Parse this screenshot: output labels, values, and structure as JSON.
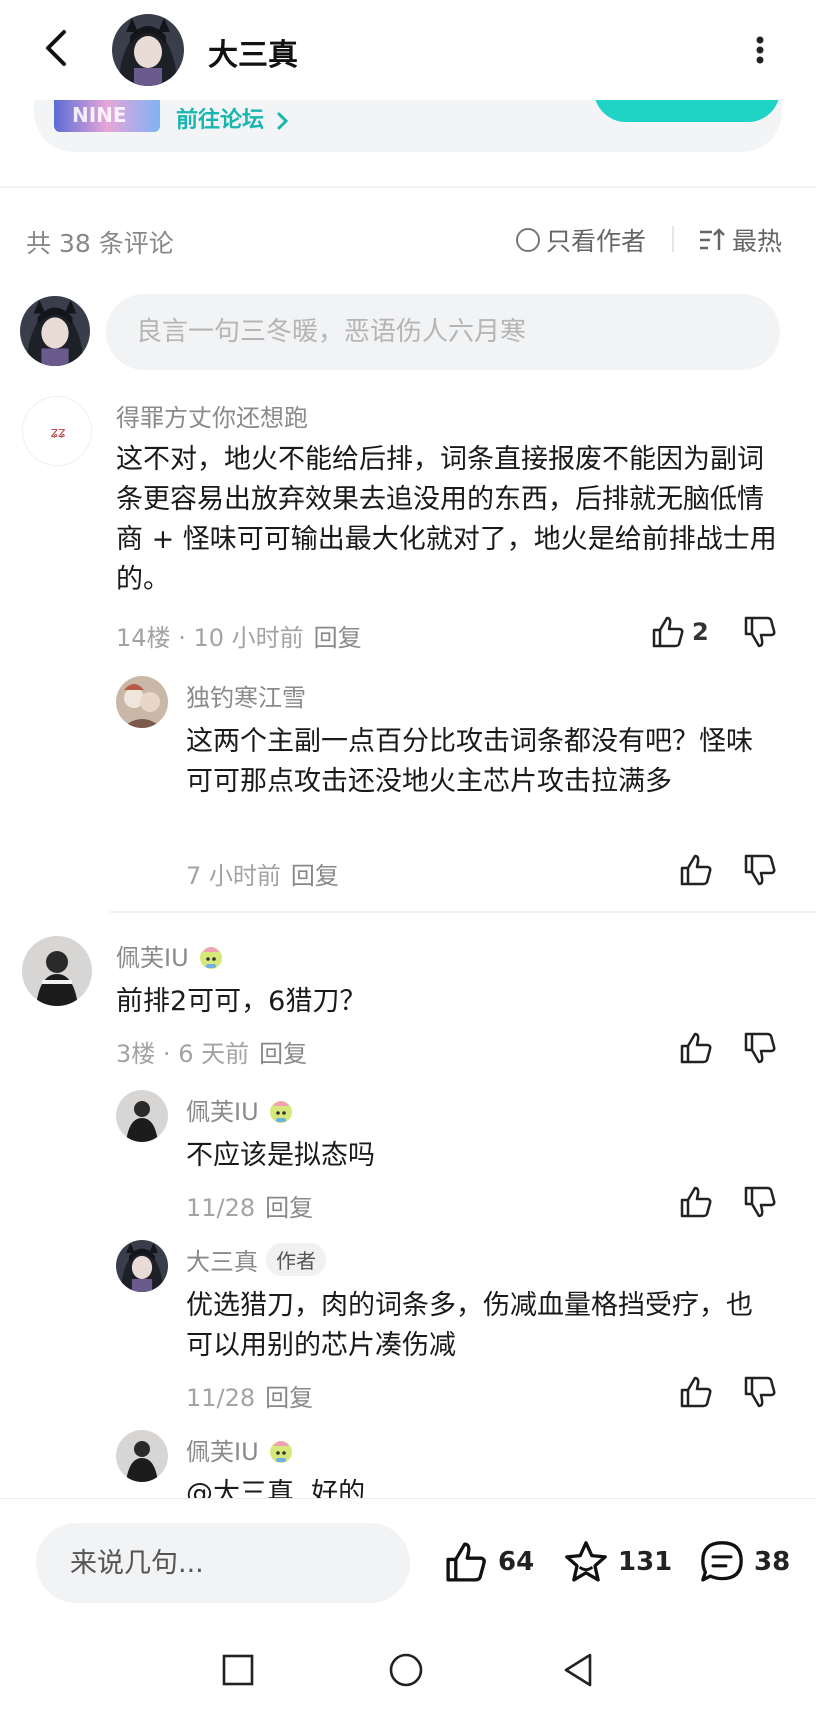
{
  "header": {
    "title": "大三真",
    "back_icon": "back-arrow-icon",
    "more_icon": "more-vertical-icon"
  },
  "forum_card": {
    "link_label": "前往论坛"
  },
  "comments_header": {
    "count_label": "共 38 条评论",
    "only_author_label": "只看作者",
    "sort_label": "最热"
  },
  "composer": {
    "placeholder": "良言一句三冬暖，恶语伤人六月寒"
  },
  "comments": [
    {
      "username": "得罪方丈你还想跑",
      "text": "这不对，地火不能给后排，词条直接报废不能因为副词条更容易出放弃效果去追没用的东西，后排就无脑低情商 + 怪味可可输出最大化就对了，地火是给前排战士用的。",
      "floor": "14楼",
      "sep": "·",
      "time": "10 小时前",
      "reply_label": "回复",
      "likes": "2",
      "replies": [
        {
          "username": "独钓寒江雪",
          "text": "这两个主副一点百分比攻击词条都没有吧？怪味可可那点攻击还没地火主芯片攻击拉满多",
          "time": "7 小时前",
          "reply_label": "回复"
        }
      ]
    },
    {
      "username": "佩芙IU",
      "text": "前排2可可，6猎刀？",
      "floor": "3楼",
      "sep": "·",
      "time": "6 天前",
      "reply_label": "回复",
      "replies": [
        {
          "username": "佩芙IU",
          "text": "不应该是拟态吗",
          "time": "11/28",
          "reply_label": "回复"
        },
        {
          "username": "大三真",
          "author_tag": "作者",
          "text": "优选猎刀，肉的词条多，伤减血量格挡受疗，也可以用别的芯片凑伤减",
          "time": "11/28",
          "reply_label": "回复"
        },
        {
          "username": "佩芙IU",
          "text": "@大三真  好的"
        }
      ]
    }
  ],
  "bottom_bar": {
    "input_placeholder": "来说几句...",
    "likes": "64",
    "favorites": "131",
    "comments": "38"
  },
  "colors": {
    "accent": "#18b6b0",
    "accent_button": "#1fd3c5",
    "muted_text": "#8a8a8a",
    "input_bg": "#f2f3f5"
  }
}
